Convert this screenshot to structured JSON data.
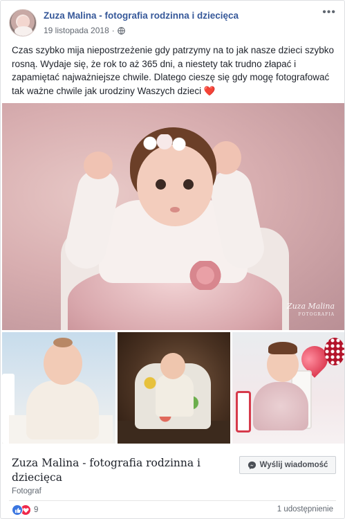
{
  "header": {
    "page_name": "Zuza Malina - fotografia rodzinna i dziecięca",
    "date": "19 listopada 2018",
    "date_separator": "·",
    "audience_icon": "globe-icon",
    "more_icon": "more-options-icon",
    "more_glyph": "•••"
  },
  "post": {
    "text": "Czas szybko mija niepostrzeżenie gdy patrzymy na to jak nasze dzieci szybko rosną. Wydaje się, że rok to aż 365 dni, a niestety tak trudno złapać i zapamiętać najważniejsze chwile. Dlatego cieszę się gdy mogę fotografować tak ważne chwile jak urodziny Waszych dzieci",
    "heart": "❤️"
  },
  "photos": {
    "watermark_name": "Zuza Malina",
    "watermark_sub": "FOTOGRAFIA"
  },
  "page_card": {
    "name": "Zuza Malina - fotografia rodzinna i dziecięca",
    "category": "Fotograf",
    "message_button": "Wyślij wiadomość"
  },
  "footer": {
    "reaction_icons": [
      "like-icon",
      "love-icon"
    ],
    "reaction_count": "9",
    "shares": "1 udostępnienie"
  },
  "colors": {
    "link": "#365899",
    "like": "#3b76e0",
    "love": "#f0284a"
  }
}
